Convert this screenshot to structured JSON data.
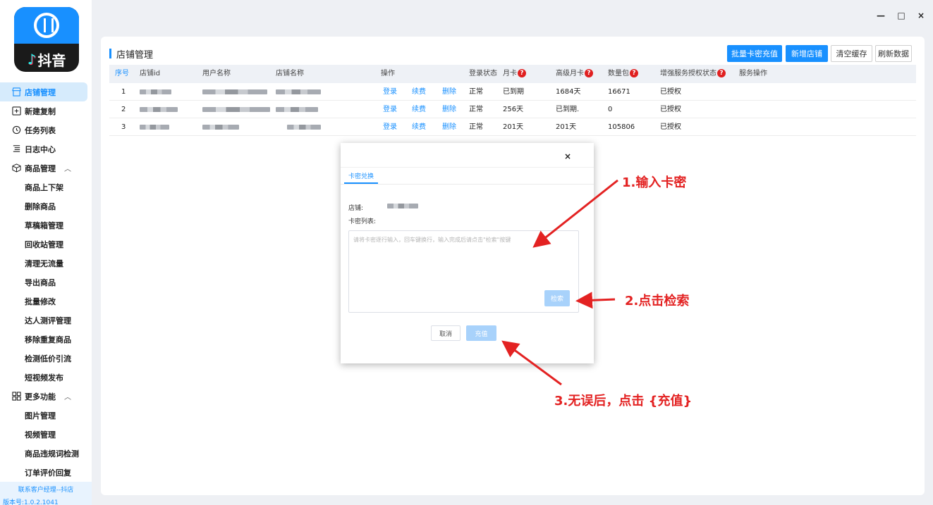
{
  "app": {
    "logo_text": "抖音",
    "version": "版本号:1.0.2.1041",
    "contact": "联系客户经理--抖店"
  },
  "sidebar": {
    "items": [
      {
        "label": "店铺管理",
        "icon": "store-icon",
        "active": true
      },
      {
        "label": "新建复制",
        "icon": "copy-add-icon"
      },
      {
        "label": "任务列表",
        "icon": "task-list-icon"
      },
      {
        "label": "日志中心",
        "icon": "log-icon"
      },
      {
        "label": "商品管理",
        "icon": "box-icon",
        "expandable": true
      }
    ],
    "goods_sub": [
      "商品上下架",
      "删除商品",
      "草稿箱管理",
      "回收站管理",
      "清理无流量",
      "导出商品",
      "批量修改",
      "达人测评管理",
      "移除重复商品",
      "检测低价引流",
      "短视频发布"
    ],
    "more": {
      "label": "更多功能",
      "icon": "grid-icon"
    },
    "more_sub": [
      "图片管理",
      "视频管理",
      "商品违规词检测",
      "订单评价回复"
    ]
  },
  "window": {
    "minimize": "—",
    "maximize": "□",
    "close": "×"
  },
  "main": {
    "title": "店铺管理",
    "buttons": {
      "batch_recharge": "批量卡密充值",
      "add_store": "新增店铺",
      "clear_cache": "清空缓存",
      "refresh": "刷新数据"
    },
    "columns": [
      "序号",
      "店铺id",
      "用户名称",
      "店铺名称",
      "操作",
      "登录状态",
      "月卡",
      "高级月卡",
      "数量包",
      "增强服务授权状态",
      "服务操作"
    ],
    "action_labels": {
      "login": "登录",
      "renew": "续费",
      "delete": "删除"
    },
    "rows": [
      {
        "seq": "1",
        "status": "正常",
        "monthly": "已到期",
        "advanced": "1684天",
        "package": "16671",
        "auth": "已授权"
      },
      {
        "seq": "2",
        "status": "正常",
        "monthly": "256天",
        "advanced": "已到期.",
        "package": "0",
        "auth": "已授权"
      },
      {
        "seq": "3",
        "status": "正常",
        "monthly": "201天",
        "advanced": "201天",
        "package": "105806",
        "auth": "已授权"
      }
    ]
  },
  "modal": {
    "close": "×",
    "tab": "卡密兑换",
    "store_label": "店铺:",
    "list_label": "卡密列表:",
    "placeholder": "请将卡密逐行输入，回车键换行，输入完成后请点击\"检索\"按键",
    "search": "检索",
    "cancel": "取消",
    "recharge": "充值"
  },
  "annotations": {
    "step1": "1.输入卡密",
    "step2": "2.点击检索",
    "step3": "3.无误后，点击 {充值}",
    "color": "#e32222"
  }
}
